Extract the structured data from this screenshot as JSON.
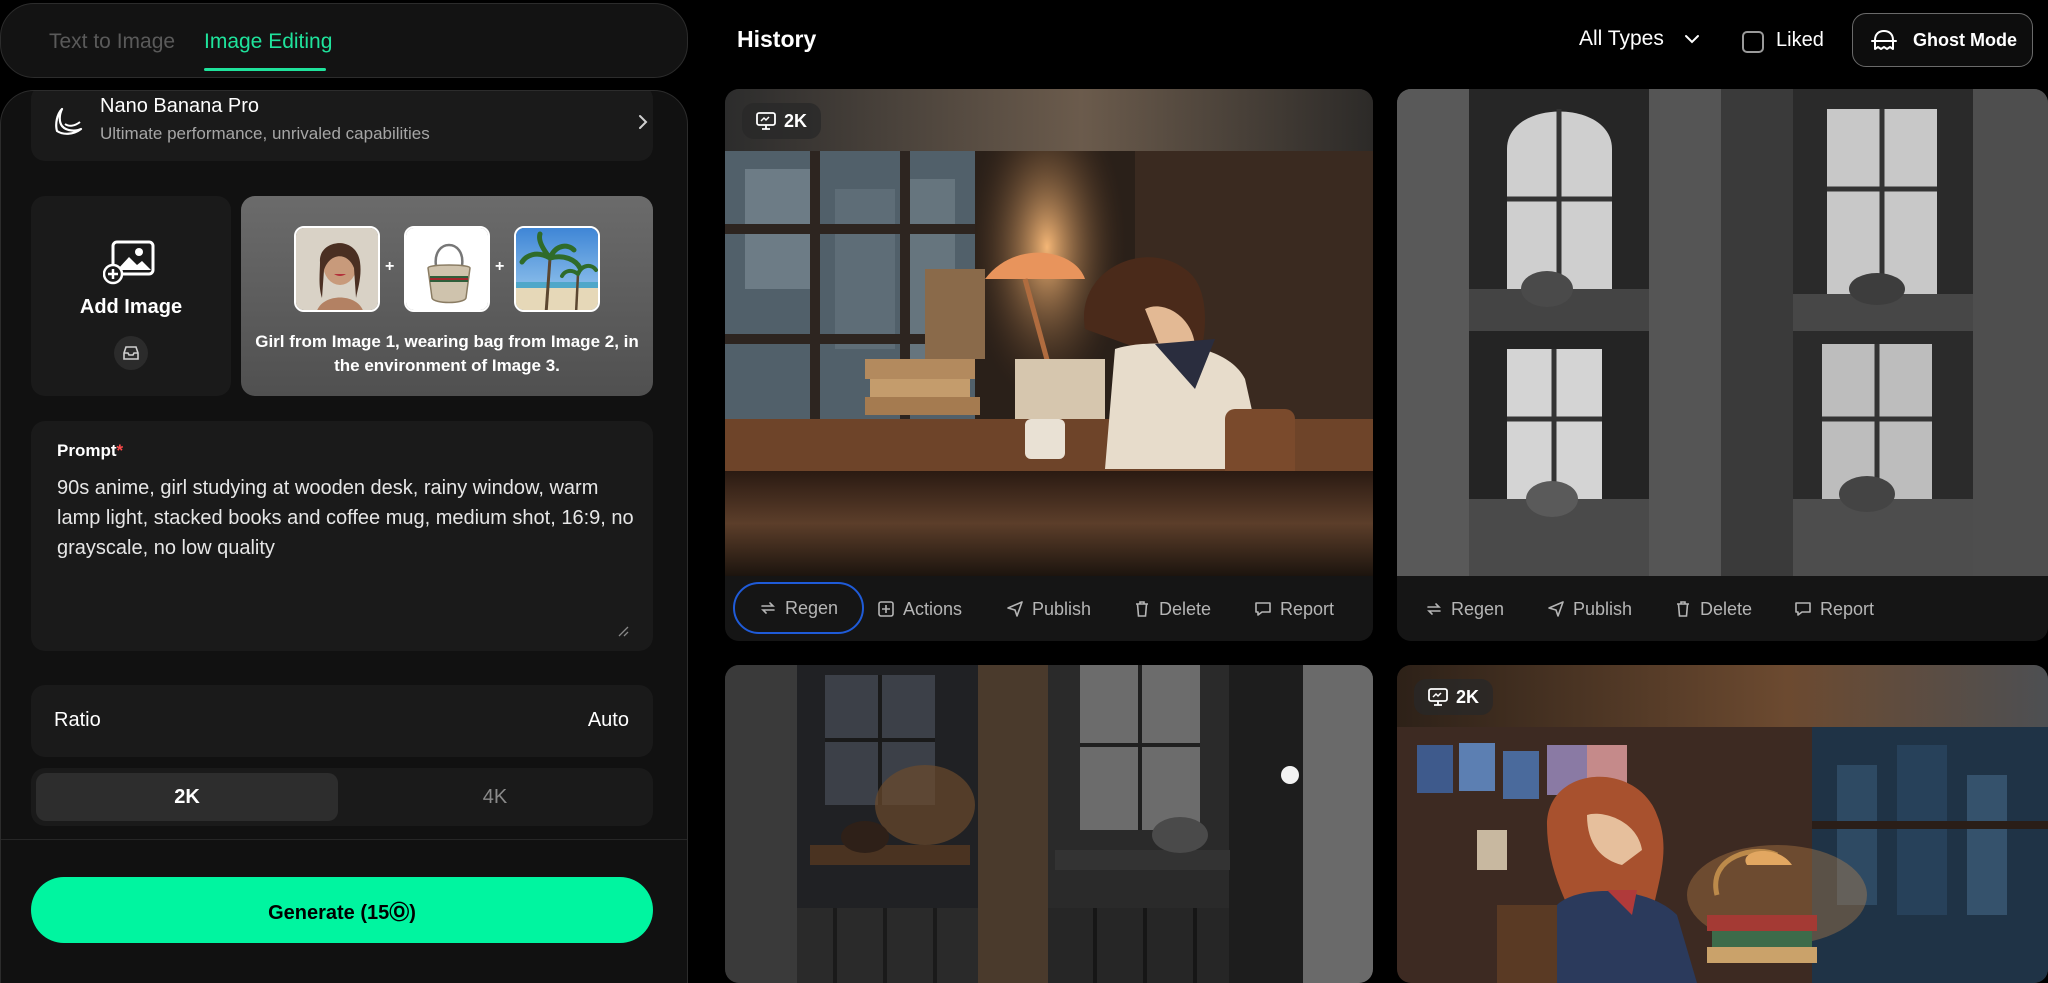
{
  "tabs": {
    "text_to_image": "Text to Image",
    "image_editing": "Image Editing"
  },
  "model": {
    "name": "Nano Banana Pro",
    "description": "Ultimate performance, unrivaled capabilities"
  },
  "add_image": {
    "label": "Add Image"
  },
  "example": {
    "caption": "Girl from Image 1, wearing bag from Image 2, in the environment of Image 3.",
    "plus": "+"
  },
  "prompt": {
    "label": "Prompt",
    "required_mark": "*",
    "value": "90s anime, girl studying at wooden desk, rainy window, warm lamp light, stacked books and coffee mug, medium shot, 16:9, no grayscale, no low quality"
  },
  "ratio": {
    "label": "Ratio",
    "value": "Auto"
  },
  "resolution": {
    "options": [
      "2K",
      "4K"
    ],
    "selected": "2K"
  },
  "generate": {
    "label": "Generate (15Ⓞ)"
  },
  "header": {
    "title": "History",
    "filter_label": "All Types",
    "liked_label": "Liked",
    "ghost_mode_label": "Ghost Mode"
  },
  "cards": [
    {
      "badge": "2K",
      "actions": [
        "Regen",
        "Actions",
        "Publish",
        "Delete",
        "Report"
      ]
    },
    {
      "badge": "",
      "actions": [
        "Regen",
        "Publish",
        "Delete",
        "Report"
      ]
    },
    {
      "badge": "",
      "actions": []
    },
    {
      "badge": "2K",
      "actions": []
    }
  ],
  "colors": {
    "accent": "#1fe39c",
    "generate_bg": "#00f5a0",
    "active_outline": "#1f5bd8",
    "required": "#ff4a4a"
  }
}
